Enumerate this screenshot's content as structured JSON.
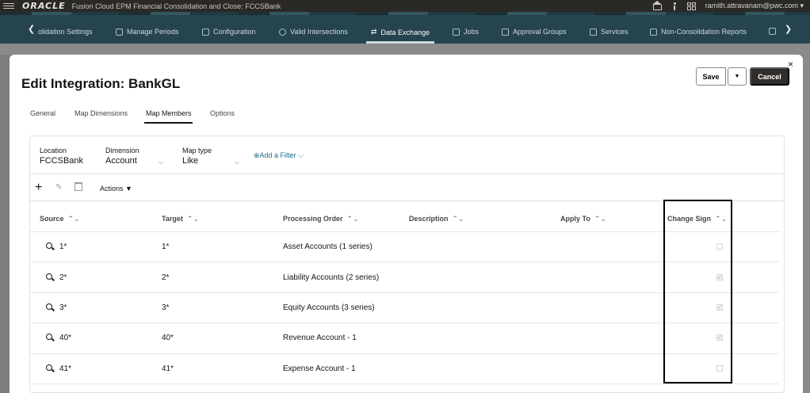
{
  "header": {
    "logo": "ORACLE",
    "app_title": "Fusion Cloud EPM Financial Consolidation and Close: FCCSBank",
    "user": "ramith.attravanam@pwc.com ▾"
  },
  "nav": {
    "items": [
      {
        "label": "olidation Settings",
        "icon": "settings-icon"
      },
      {
        "label": "Manage Periods",
        "icon": "calendar-icon"
      },
      {
        "label": "Configuration",
        "icon": "tools-icon"
      },
      {
        "label": "Valid Intersections",
        "icon": "intersect-icon"
      },
      {
        "label": "Data Exchange",
        "icon": "exchange-icon",
        "active": true
      },
      {
        "label": "Jobs",
        "icon": "jobs-icon"
      },
      {
        "label": "Approval Groups",
        "icon": "approval-icon"
      },
      {
        "label": "Services",
        "icon": "services-icon"
      },
      {
        "label": "Non-Consolidation Reports",
        "icon": "reports-icon"
      }
    ]
  },
  "dialog": {
    "title": "Edit Integration: BankGL",
    "save_label": "Save",
    "cancel_label": "Cancel",
    "close_glyph": "×",
    "tabs": [
      "General",
      "Map Dimensions",
      "Map Members",
      "Options"
    ],
    "active_tab": "Map Members"
  },
  "filters": {
    "location_label": "Location",
    "location_value": "FCCSBank",
    "dimension_label": "Dimension",
    "dimension_value": "Account",
    "maptype_label": "Map type",
    "maptype_value": "Like",
    "add_filter": "⊕Add a Filter"
  },
  "toolbar": {
    "actions_label": "Actions"
  },
  "table": {
    "columns": [
      "Source",
      "Target",
      "Processing Order",
      "Description",
      "Apply To",
      "Change Sign"
    ],
    "rows": [
      {
        "source": "1*",
        "target": "1*",
        "order": "Asset Accounts (1 series)",
        "description": "",
        "apply_to": "",
        "change_sign": false
      },
      {
        "source": "2*",
        "target": "2*",
        "order": "Liability Accounts (2 series)",
        "description": "",
        "apply_to": "",
        "change_sign": true
      },
      {
        "source": "3*",
        "target": "3*",
        "order": "Equity Accounts (3 series)",
        "description": "",
        "apply_to": "",
        "change_sign": true
      },
      {
        "source": "40*",
        "target": "40*",
        "order": "Revenue Account - 1",
        "description": "",
        "apply_to": "",
        "change_sign": true
      },
      {
        "source": "41*",
        "target": "41*",
        "order": "Expense Account - 1",
        "description": "",
        "apply_to": "",
        "change_sign": false
      }
    ]
  },
  "colors": {
    "header_bg": "#2b2926",
    "nav_bg": "#25444d",
    "cancel_bg": "#312d2a",
    "link": "#1d6b8a",
    "highlight_border": "#000000"
  }
}
